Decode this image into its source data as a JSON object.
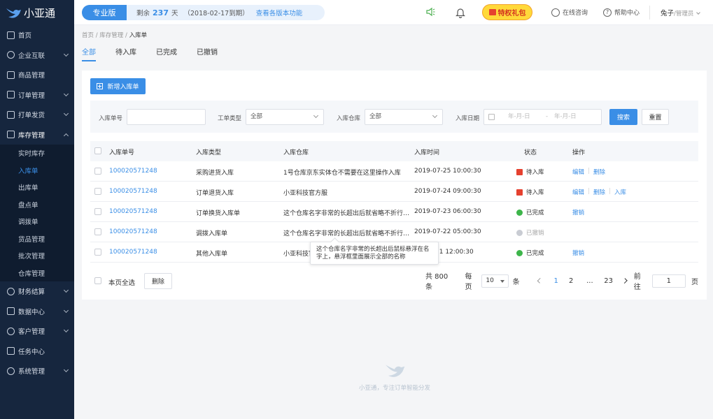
{
  "app": {
    "name": "小亚通"
  },
  "sidebar": {
    "items": [
      {
        "label": "首页"
      },
      {
        "label": "企业互联"
      },
      {
        "label": "商品管理"
      },
      {
        "label": "订单管理"
      },
      {
        "label": "打单发货"
      },
      {
        "label": "库存管理"
      },
      {
        "label": "财务结算"
      },
      {
        "label": "数据中心"
      },
      {
        "label": "客户管理"
      },
      {
        "label": "任务中心"
      },
      {
        "label": "系统管理"
      }
    ],
    "sub_items": [
      "实时库存",
      "入库单",
      "出库单",
      "盘点单",
      "调拨单",
      "货品管理",
      "批次管理",
      "仓库管理"
    ]
  },
  "topbar": {
    "edition": "专业版",
    "remaining_prefix": "剩余",
    "remaining_days": "237",
    "remaining_unit": "天",
    "expire_text": "（2018-02-17到期）",
    "view_versions": "查看各版本功能",
    "gift_label": "特权礼包",
    "consult": "在线咨询",
    "help": "帮助中心",
    "user_name": "兔子",
    "user_role": "/管理员"
  },
  "breadcrumb": {
    "home": "首页 / ",
    "parent": "库存管理 / ",
    "current": "入库单"
  },
  "tabs": [
    "全部",
    "待入库",
    "已完成",
    "已撤销"
  ],
  "toolbar": {
    "add_label": "新增入库单"
  },
  "filters": {
    "order_no_label": "入库单号",
    "type_label": "工单类型",
    "type_value": "全部",
    "warehouse_label": "入库仓库",
    "warehouse_value": "全部",
    "date_label": "入库日期",
    "date_start_ph": "年-月-日",
    "date_sep": "-",
    "date_end_ph": "年-月-日",
    "search_label": "搜索",
    "reset_label": "重置"
  },
  "table": {
    "headers": [
      "入库单号",
      "入库类型",
      "入库仓库",
      "入库时间",
      "状态",
      "操作"
    ],
    "rows": [
      {
        "no": "100020571248",
        "type": "采购进货入库",
        "warehouse": "1号仓库京东实体仓不需要在这里操作入库",
        "time": "2019-07-25 10:00:30",
        "status": "待入库",
        "ops": [
          "编辑",
          "删除"
        ]
      },
      {
        "no": "100020571248",
        "type": "订单退货入库",
        "warehouse": "小亚科技官方服",
        "time": "2019-07-24 09:00:30",
        "status": "待入库",
        "ops": [
          "编辑",
          "删除",
          "入库"
        ]
      },
      {
        "no": "100020571248",
        "type": "订单换货入库单",
        "warehouse": "这个仓库名字非常的长超出后就省略不折行…",
        "time": "2019-07-23 06:00:30",
        "status": "已完成",
        "ops": [
          "撤销"
        ]
      },
      {
        "no": "100020571248",
        "type": "调拨入库单",
        "warehouse": "这个仓库名字非常的长超出后就省略不折行…",
        "time": "2019-07-22 05:00:30",
        "status": "已撤销",
        "ops": []
      },
      {
        "no": "100020571248",
        "type": "其他入库单",
        "warehouse": "小亚科技官",
        "time": "21 12:00:30",
        "status": "已完成",
        "ops": [
          "撤销"
        ]
      }
    ]
  },
  "tooltip": {
    "text": "这个仓库名字非常的长超出后鼠标悬浮在名字上，悬浮框里面展示全部的名称"
  },
  "footer": {
    "select_all": "本页全选",
    "delete_label": "删除",
    "total": "共 800 条",
    "per_page_label": "每页",
    "per_page_value": "10",
    "per_page_unit": "条",
    "pages": [
      "1",
      "2",
      "...",
      "23"
    ],
    "goto_label": "前往",
    "goto_value": "1",
    "goto_unit": "页"
  },
  "brand_footer": {
    "slogan": "小亚通，专注订单智能分发"
  },
  "colors": {
    "primary": "#3a8ee6",
    "sidebar_bg": "#16263e",
    "success": "#3db54a",
    "pending": "#e5412f"
  }
}
